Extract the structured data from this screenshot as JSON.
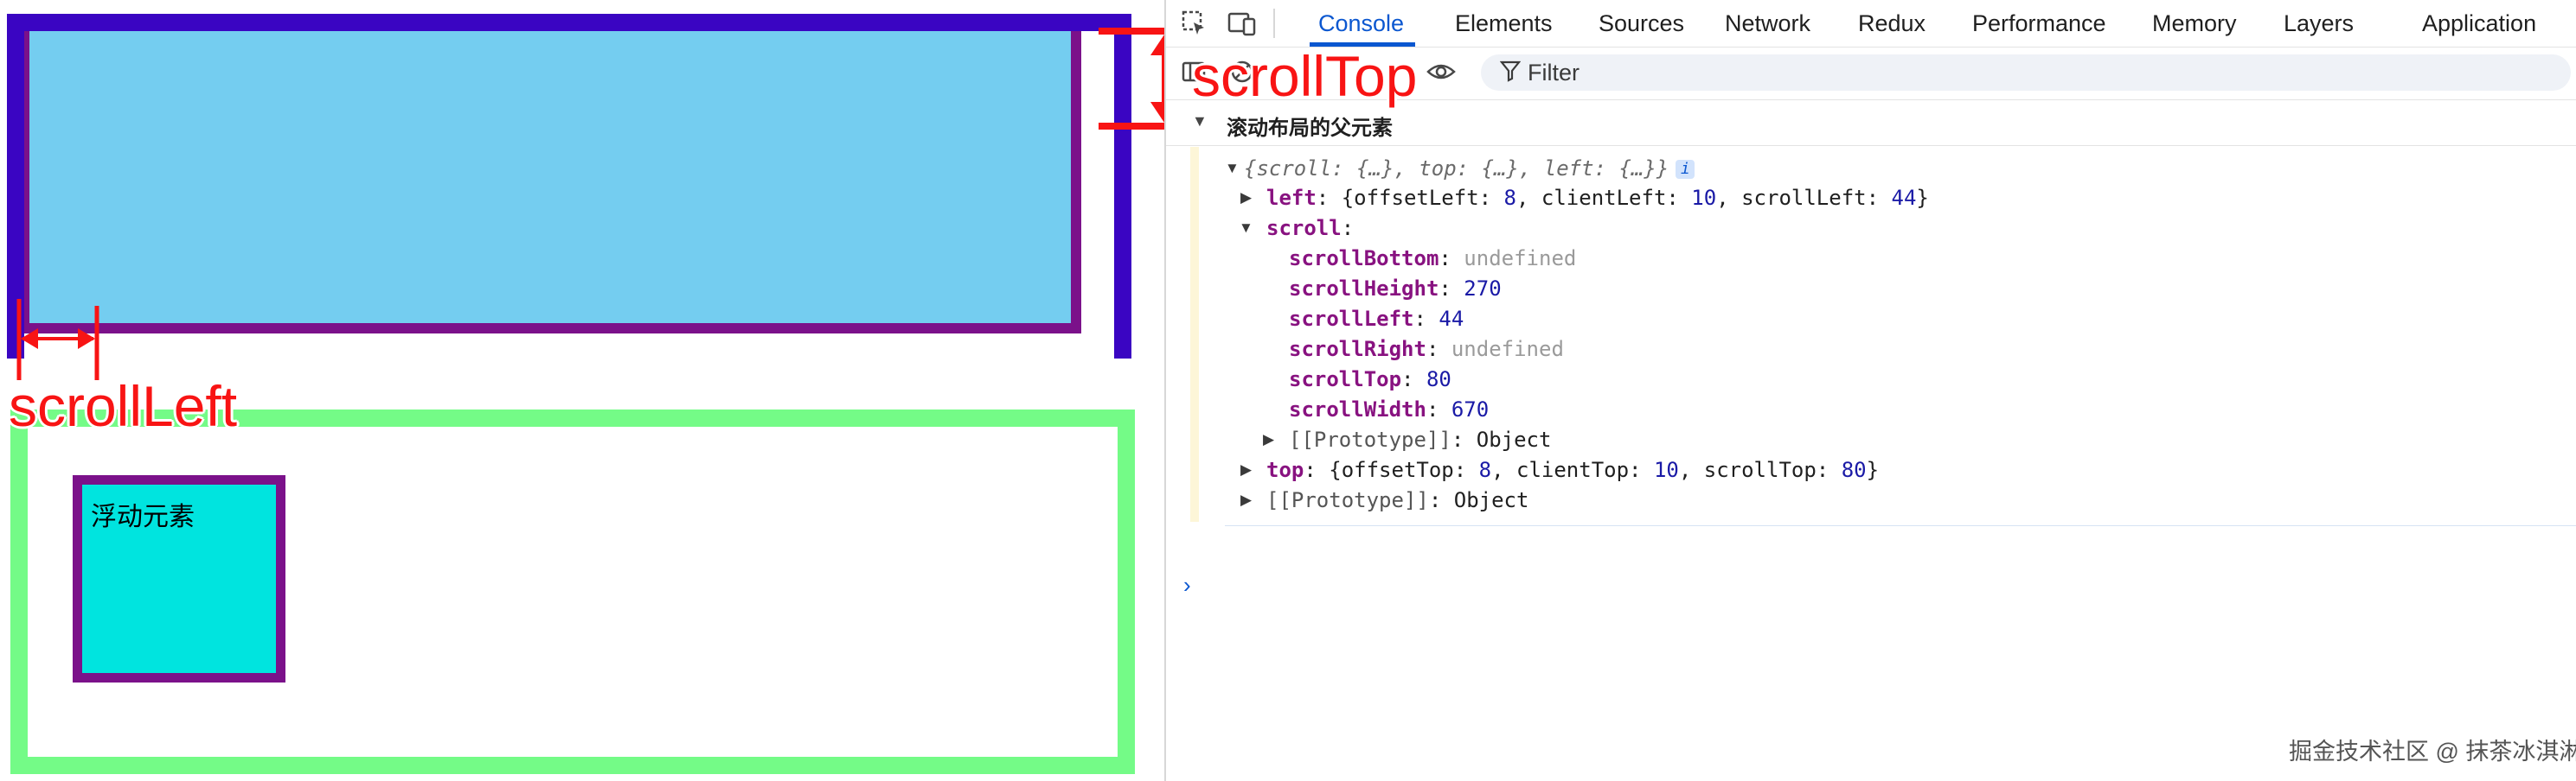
{
  "page": {
    "float_label": "浮动元素",
    "annotations": {
      "scroll_top": "scrollTop",
      "scroll_left": "scrollLeft"
    }
  },
  "devtools": {
    "tabs": [
      "Console",
      "Elements",
      "Sources",
      "Network",
      "Redux",
      "Performance",
      "Memory",
      "Layers",
      "Application"
    ],
    "active_tab": "Console",
    "filter_label": "Filter",
    "group_title": "滚动布局的父元素",
    "log": {
      "summary": "{scroll: {…}, top: {…}, left: {…}}",
      "info_badge": "i",
      "left_line": {
        "key": "left",
        "text_a": ": {offsetLeft: ",
        "offsetLeft": "8",
        "text_b": ", clientLeft: ",
        "clientLeft": "10",
        "text_c": ", scrollLeft: ",
        "scrollLeft": "44",
        "text_d": "}"
      },
      "scroll_key": "scroll",
      "scroll_props": [
        {
          "key": "scrollBottom",
          "value": "undefined",
          "kind": "undef"
        },
        {
          "key": "scrollHeight",
          "value": "270",
          "kind": "num"
        },
        {
          "key": "scrollLeft",
          "value": "44",
          "kind": "num"
        },
        {
          "key": "scrollRight",
          "value": "undefined",
          "kind": "undef"
        },
        {
          "key": "scrollTop",
          "value": "80",
          "kind": "num"
        },
        {
          "key": "scrollWidth",
          "value": "670",
          "kind": "num"
        }
      ],
      "proto_inner": "[[Prototype]]",
      "proto_inner_value": "Object",
      "top_line": {
        "key": "top",
        "text_a": ": {offsetTop: ",
        "offsetTop": "8",
        "text_b": ", clientTop: ",
        "clientTop": "10",
        "text_c": ", scrollTop: ",
        "scrollTop": "80",
        "text_d": "}"
      },
      "proto_outer": "[[Prototype]]",
      "proto_outer_value": "Object"
    },
    "prompt_glyph": "›"
  },
  "watermark": "掘金技术社区 @ 抹茶冰淇淋",
  "colors": {
    "scroll_parent_border": "#3a05c2",
    "scroll_child_border": "#7b118a",
    "scroll_child_fill": "#74cdf0",
    "float_parent_border": "#74fb87",
    "float_child_fill": "#00e4df",
    "annotation": "#f81414",
    "accent": "#0b57d0"
  },
  "icons": [
    "inspect-element-icon",
    "device-toolbar-icon",
    "sidebar-icon",
    "clear-console-icon",
    "live-expression-eye-icon",
    "filter-icon",
    "arrow-icon"
  ]
}
